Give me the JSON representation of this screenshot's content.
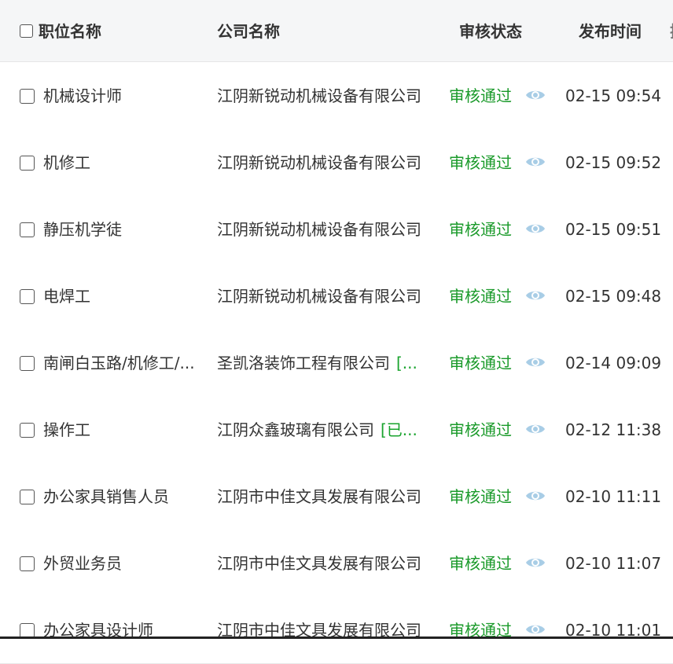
{
  "header": {
    "col_name": "职位名称",
    "col_company": "公司名称",
    "col_status": "审核状态",
    "col_time": "发布时间",
    "col_more": "操"
  },
  "colors": {
    "status_green": "#1a9a2a",
    "eye_icon": "#a8cde6"
  },
  "rows": [
    {
      "name": "机械设计师",
      "company": "江阴新锐动机械设备有限公司",
      "tag": "",
      "status": "审核通过",
      "time": "02-15 09:54"
    },
    {
      "name": "机修工",
      "company": "江阴新锐动机械设备有限公司",
      "tag": "",
      "status": "审核通过",
      "time": "02-15 09:52"
    },
    {
      "name": "静压机学徒",
      "company": "江阴新锐动机械设备有限公司",
      "tag": "",
      "status": "审核通过",
      "time": "02-15 09:51"
    },
    {
      "name": "电焊工",
      "company": "江阴新锐动机械设备有限公司",
      "tag": "",
      "status": "审核通过",
      "time": "02-15 09:48"
    },
    {
      "name": "南闸白玉路/机修工/...",
      "company": "圣凯洛装饰工程有限公司",
      "tag": "[...",
      "status": "审核通过",
      "time": "02-14 09:09"
    },
    {
      "name": "操作工",
      "company": "江阴众鑫玻璃有限公司",
      "tag": "[已...",
      "status": "审核通过",
      "time": "02-12 11:38"
    },
    {
      "name": "办公家具销售人员",
      "company": "江阴市中佳文具发展有限公司",
      "tag": "",
      "status": "审核通过",
      "time": "02-10 11:11"
    },
    {
      "name": "外贸业务员",
      "company": "江阴市中佳文具发展有限公司",
      "tag": "",
      "status": "审核通过",
      "time": "02-10 11:07"
    },
    {
      "name": "办公家具设计师",
      "company": "江阴市中佳文具发展有限公司",
      "tag": "",
      "status": "审核通过",
      "time": "02-10 11:01"
    }
  ]
}
